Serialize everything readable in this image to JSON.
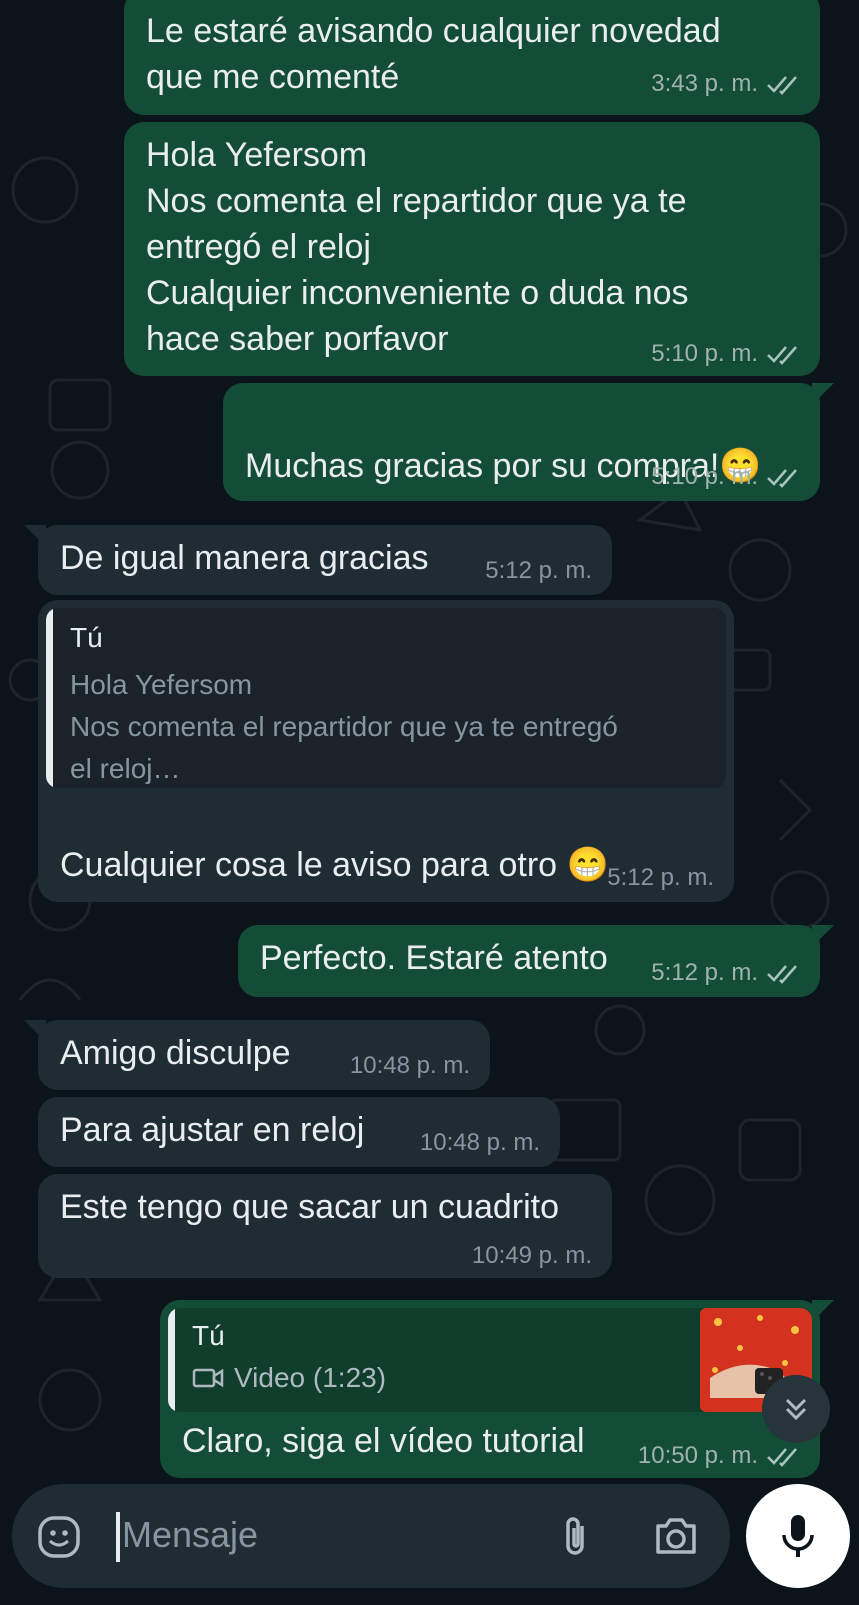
{
  "messages": [
    {
      "text": "Le estaré avisando cualquier novedad\nque me comenté",
      "time": "3:43 p. m."
    },
    {
      "text": "Hola Yefersom\nNos comenta el repartidor que ya te\nentregó el reloj\nCualquier inconveniente o duda nos\nhace saber porfavor",
      "time": "5:10 p. m."
    },
    {
      "text": "Muchas gracias por su compra!",
      "emoji": "😁",
      "time": "5:10 p. m."
    },
    {
      "text": "De igual manera gracias",
      "time": "5:12 p. m."
    },
    {
      "quote_author": "Tú",
      "quote_text": "Hola Yefersom\nNos comenta el repartidor que ya te entregó\nel reloj…",
      "text": "Cualquier cosa le aviso para otro",
      "emoji": "😁",
      "time": "5:12 p. m."
    },
    {
      "text": "Perfecto. Estaré atento",
      "time": "5:12 p. m."
    },
    {
      "text": "Amigo disculpe",
      "time": "10:48 p. m."
    },
    {
      "text": "Para ajustar en reloj",
      "time": "10:48 p. m."
    },
    {
      "text": "Este tengo que sacar un cuadrito",
      "time": "10:49 p. m."
    },
    {
      "quote_author": "Tú",
      "quote_video": "Video (1:23)",
      "text": "Claro, siga el vídeo tutorial",
      "time": "10:50 p. m."
    }
  ],
  "composer": {
    "placeholder": "Mensaje",
    "icons": [
      "sticker-icon",
      "attach-icon",
      "camera-icon",
      "mic-icon"
    ]
  },
  "scroll_button": {
    "icon": "double-chevron-down-icon"
  },
  "colors": {
    "background": "#0b141a",
    "outgoing_bubble": "#144d37",
    "incoming_bubble": "#1f2c34",
    "text": "#e9edef",
    "meta": "#8696a0"
  }
}
